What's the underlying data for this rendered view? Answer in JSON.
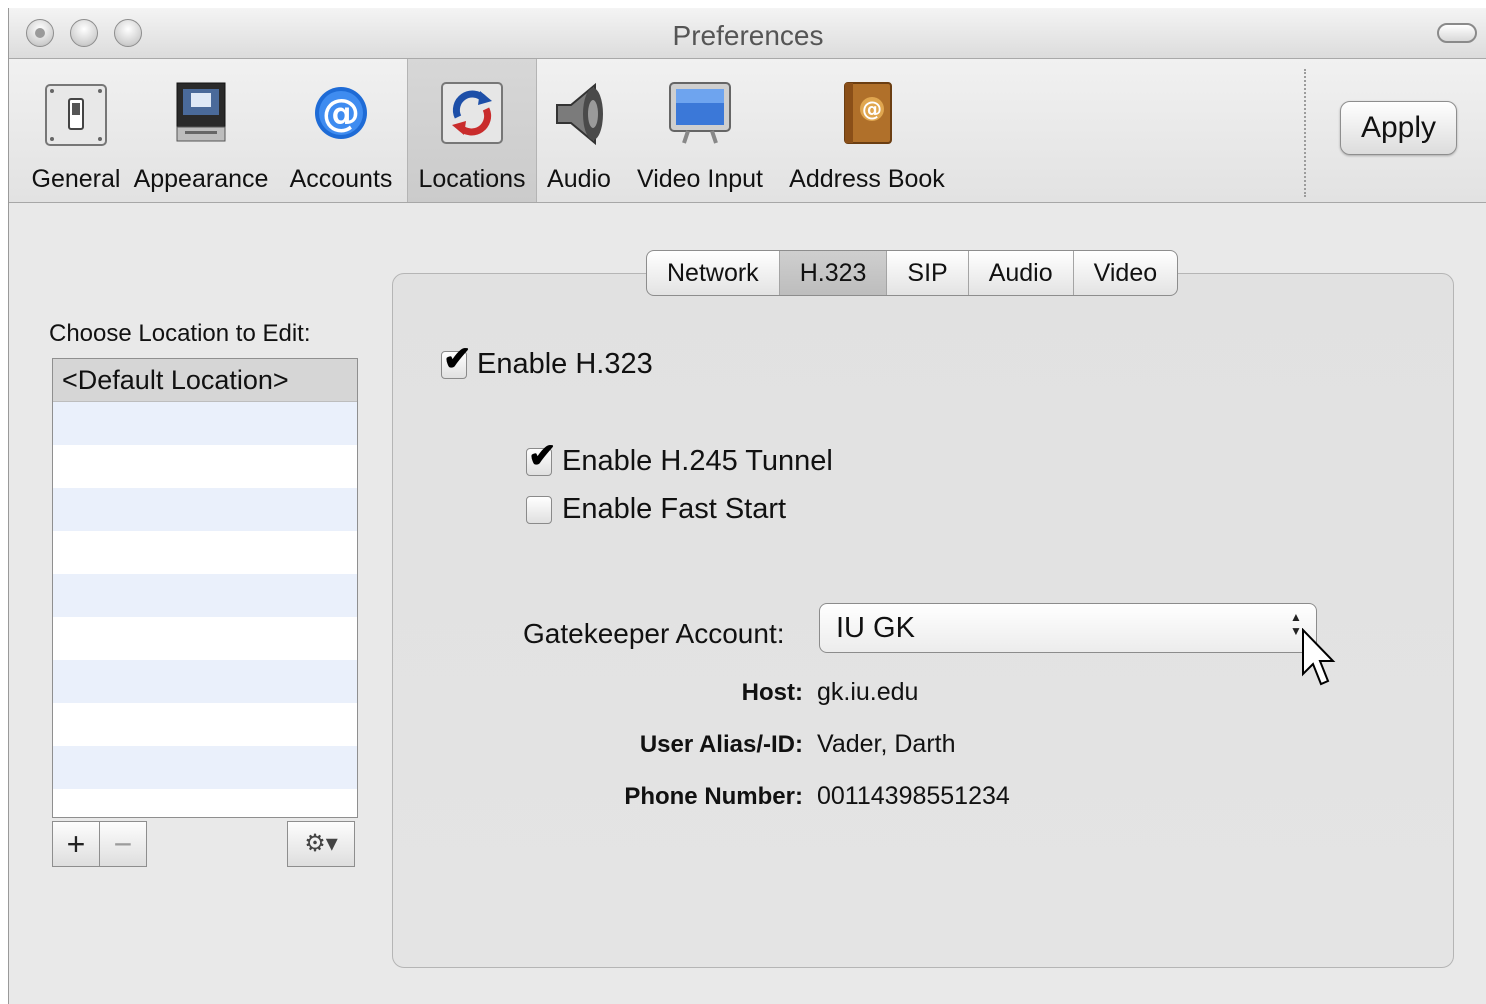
{
  "window": {
    "title": "Preferences"
  },
  "toolbar": {
    "items": [
      {
        "label": "General",
        "icon": "switch-icon"
      },
      {
        "label": "Appearance",
        "icon": "monitor-computer-icon"
      },
      {
        "label": "Accounts",
        "icon": "at-sign-icon"
      },
      {
        "label": "Locations",
        "icon": "locations-sync-icon",
        "selected": true
      },
      {
        "label": "Audio",
        "icon": "speaker-icon"
      },
      {
        "label": "Video Input",
        "icon": "display-icon"
      },
      {
        "label": "Address Book",
        "icon": "address-book-icon"
      }
    ],
    "apply_label": "Apply"
  },
  "locations": {
    "choose_label": "Choose Location to Edit:",
    "items": [
      "<Default Location>"
    ],
    "add_label": "+",
    "remove_label": "−",
    "gear_label": "⚙▾"
  },
  "tabs": [
    {
      "label": "Network"
    },
    {
      "label": "H.323",
      "active": true
    },
    {
      "label": "SIP"
    },
    {
      "label": "Audio"
    },
    {
      "label": "Video"
    }
  ],
  "h323": {
    "enable_label": "Enable H.323",
    "enable_checked": true,
    "tunnel_label": "Enable H.245 Tunnel",
    "tunnel_checked": true,
    "faststart_label": "Enable Fast Start",
    "faststart_checked": false,
    "gatekeeper_label": "Gatekeeper Account:",
    "gatekeeper_value": "IU GK",
    "host_label": "Host:",
    "host_value": "gk.iu.edu",
    "alias_label": "User Alias/-ID:",
    "alias_value": "Vader, Darth",
    "phone_label": "Phone Number:",
    "phone_value": "00114398551234"
  },
  "marks": {
    "check": "✔"
  }
}
